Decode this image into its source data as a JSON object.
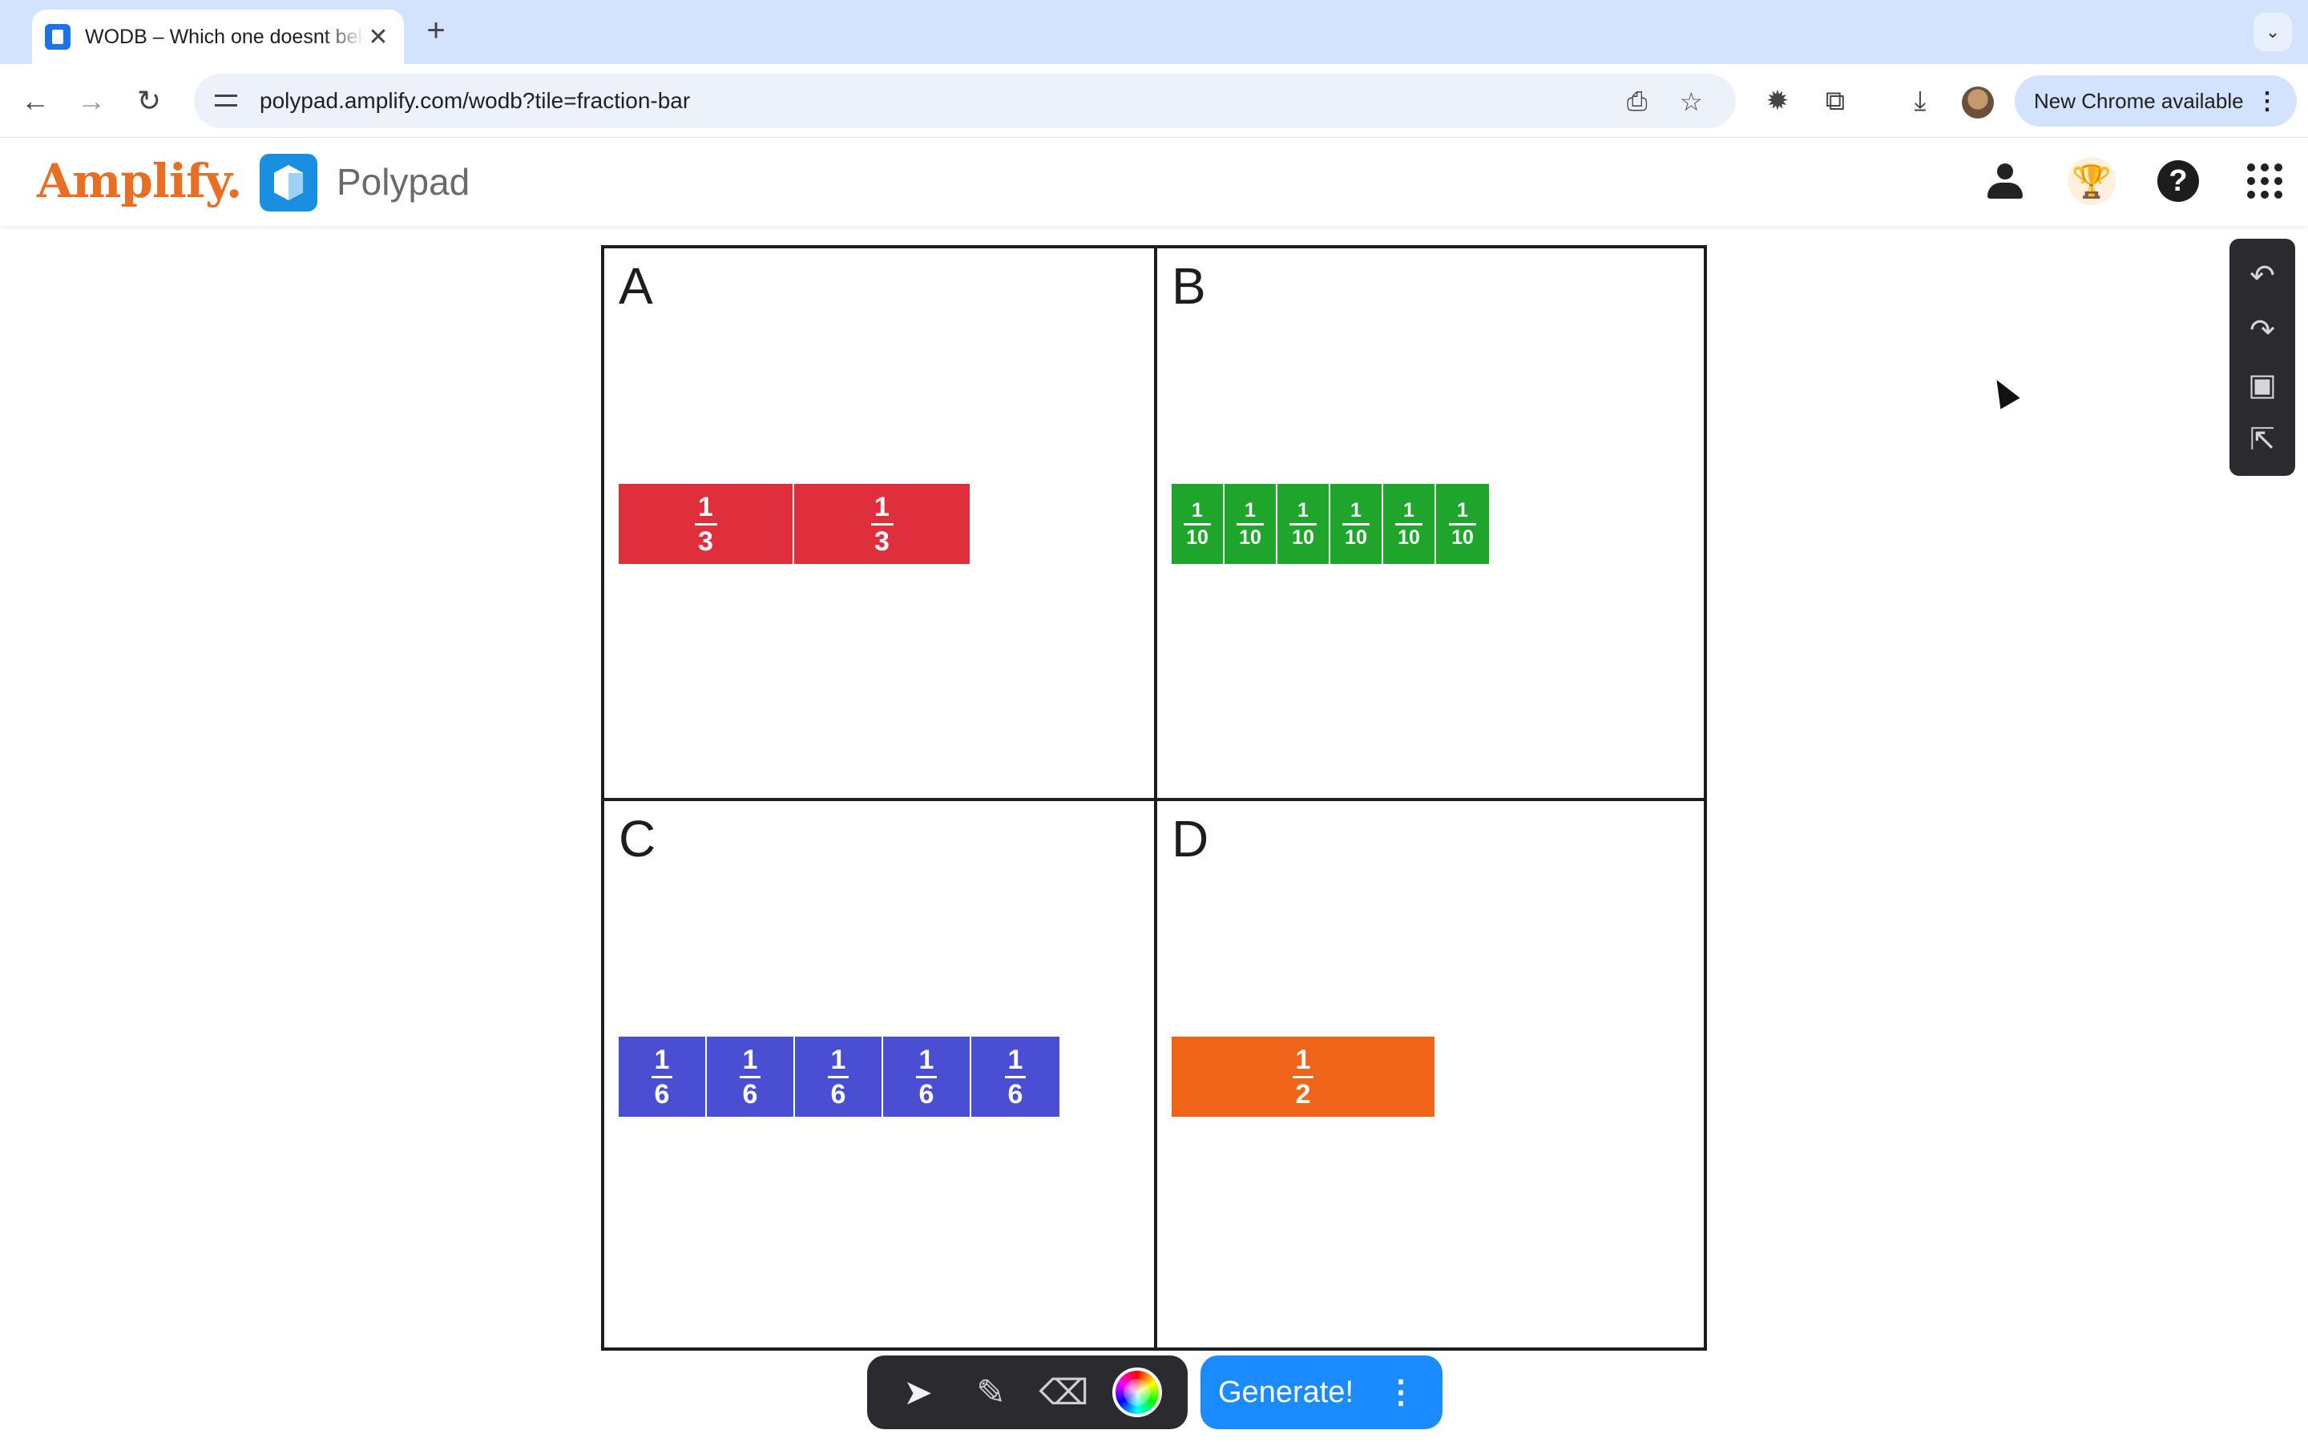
{
  "browser": {
    "tab_title": "WODB – Which one doesnt belong",
    "tab_close": "✕",
    "new_tab": "+",
    "tab_menu": "⌄",
    "url": "polypad.amplify.com/wodb?tile=fraction-bar",
    "update_label": "New Chrome available",
    "update_menu": "⋮"
  },
  "app": {
    "brand": "Amplify.",
    "product": "Polypad",
    "help": "?"
  },
  "board": {
    "quadrants": [
      {
        "label": "A",
        "color": "#e02f3c",
        "tiles": [
          {
            "num": "1",
            "den": "3"
          },
          {
            "num": "1",
            "den": "3"
          }
        ]
      },
      {
        "label": "B",
        "color": "#1fa52c",
        "tiles": [
          {
            "num": "1",
            "den": "10"
          },
          {
            "num": "1",
            "den": "10"
          },
          {
            "num": "1",
            "den": "10"
          },
          {
            "num": "1",
            "den": "10"
          },
          {
            "num": "1",
            "den": "10"
          },
          {
            "num": "1",
            "den": "10"
          }
        ]
      },
      {
        "label": "C",
        "color": "#4a4ed3",
        "tiles": [
          {
            "num": "1",
            "den": "6"
          },
          {
            "num": "1",
            "den": "6"
          },
          {
            "num": "1",
            "den": "6"
          },
          {
            "num": "1",
            "den": "6"
          },
          {
            "num": "1",
            "den": "6"
          }
        ]
      },
      {
        "label": "D",
        "color": "#ef6419",
        "tiles": [
          {
            "num": "1",
            "den": "2"
          }
        ]
      }
    ]
  },
  "bottom_toolbar": {
    "generate_label": "Generate!",
    "more": "⋮"
  },
  "icons": {
    "undo": "undo-icon",
    "redo": "redo-icon",
    "image": "image-download-icon",
    "share": "open-external-icon"
  }
}
